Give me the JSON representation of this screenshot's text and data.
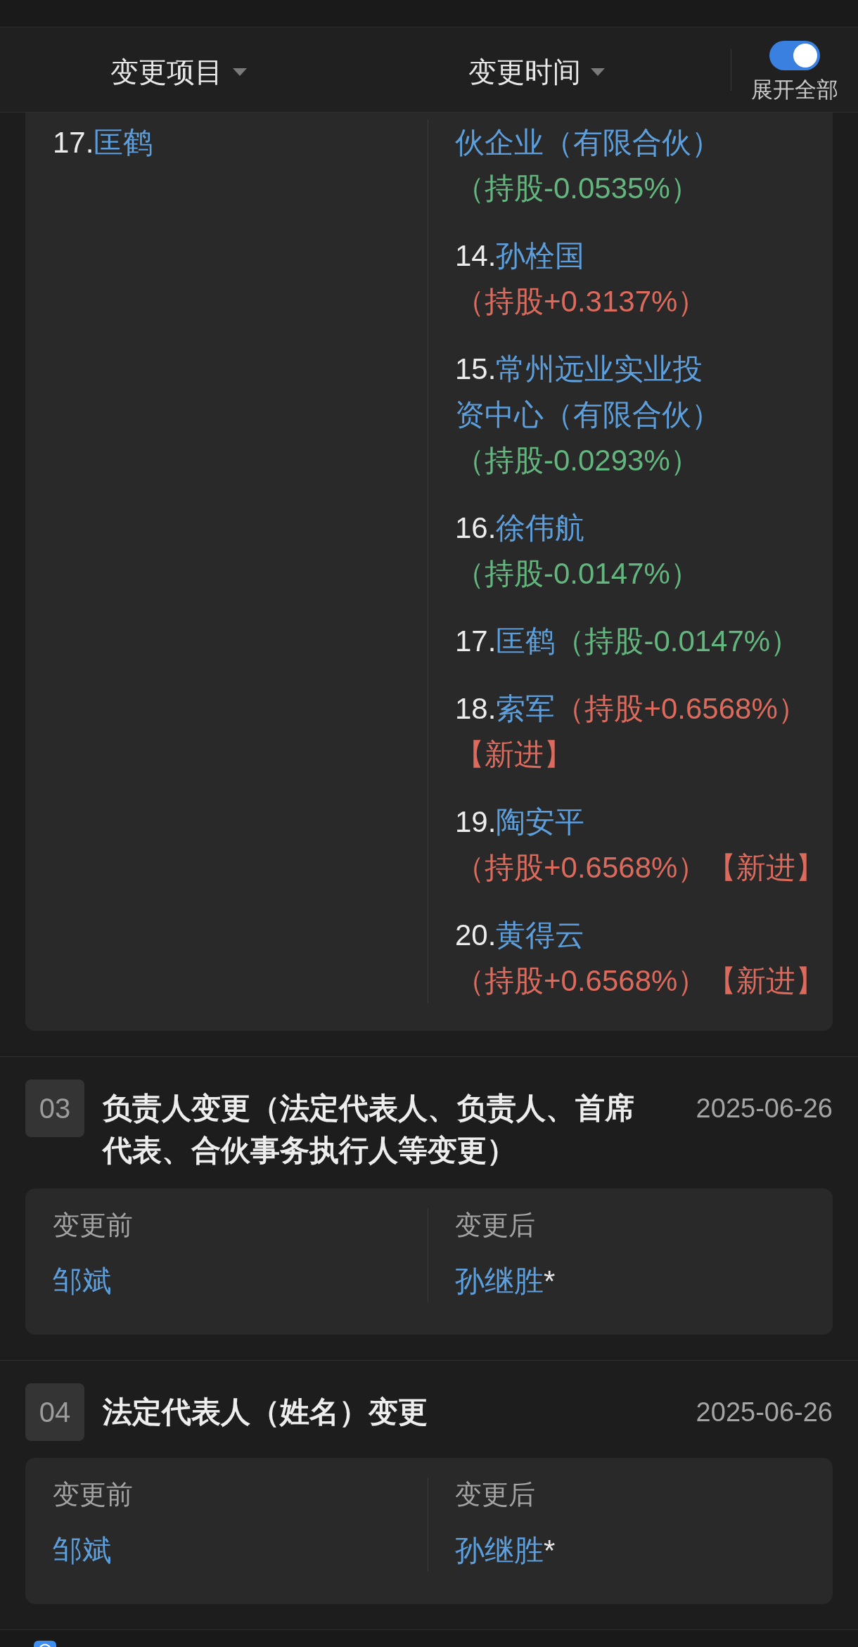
{
  "header": {
    "filters": [
      {
        "label": "变更项目"
      },
      {
        "label": "变更时间"
      }
    ],
    "toggle": {
      "label": "展开全部",
      "on": true
    }
  },
  "continued_card": {
    "before": [
      {
        "no": "17.",
        "name": "匡鹤"
      }
    ],
    "after": [
      {
        "name": "伙企业（有限合伙）",
        "share": "（持股-0.0535%）",
        "color": "#62b67e"
      },
      {
        "no": "14.",
        "name": "孙栓国",
        "share": "（持股+0.3137%）",
        "color": "#dc6a5d"
      },
      {
        "no": "15.",
        "name": "常州远业实业投资中心（有限合伙）",
        "share": "（持股-0.0293%）",
        "color": "#62b67e"
      },
      {
        "no": "16.",
        "name": "徐伟航",
        "share": "（持股-0.0147%）",
        "color": "#62b67e"
      },
      {
        "no": "17.",
        "name": "匡鹤",
        "share": "（持股-0.0147%）",
        "color": "#62b67e"
      },
      {
        "no": "18.",
        "name": "索军",
        "share": "（持股+0.6568%）",
        "color": "#dc6a5d",
        "tag": "【新进】"
      },
      {
        "no": "19.",
        "name": "陶安平",
        "share": "（持股+0.6568%）",
        "color": "#dc6a5d",
        "tag": "【新进】"
      },
      {
        "no": "20.",
        "name": "黄得云",
        "share": "（持股+0.6568%）",
        "color": "#dc6a5d",
        "tag": "【新进】"
      }
    ]
  },
  "sections": [
    {
      "number": "03",
      "title": "负责人变更（法定代表人、负责人、首席代表、合伙事务执行人等变更）",
      "date": "2025-06-26",
      "columns": [
        {
          "label": "变更前",
          "value": "邹斌"
        },
        {
          "label": "变更后",
          "value": "孙继胜",
          "suffix": "*"
        }
      ]
    },
    {
      "number": "04",
      "title": "法定代表人（姓名）变更",
      "date": "2025-06-26",
      "columns": [
        {
          "label": "变更前",
          "value": "邹斌"
        },
        {
          "label": "变更后",
          "value": "孙继胜",
          "suffix": "*"
        }
      ]
    }
  ]
}
